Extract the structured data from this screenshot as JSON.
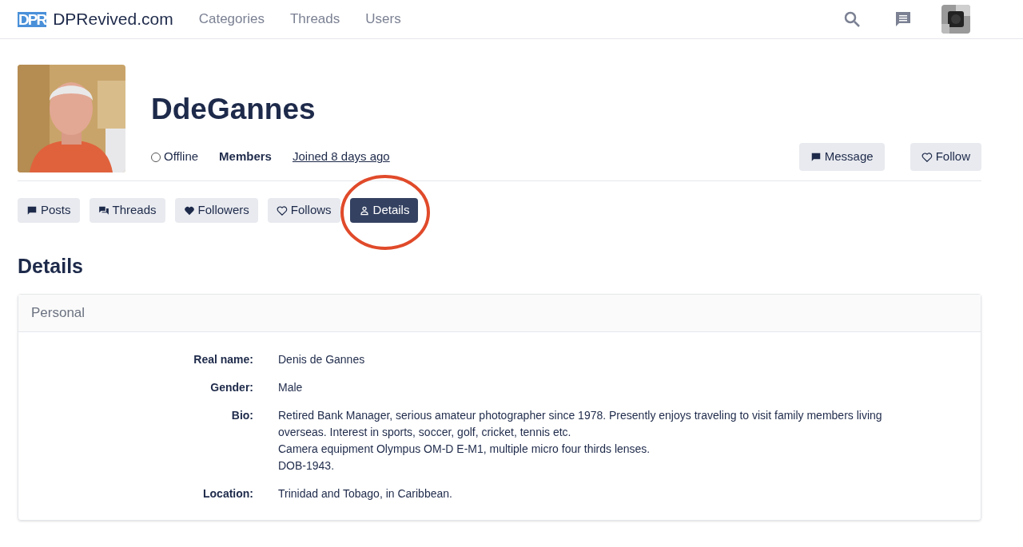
{
  "site": {
    "logo": "DPR",
    "name": "DPRevived.com",
    "nav": [
      "Categories",
      "Threads",
      "Users"
    ]
  },
  "profile": {
    "username": "DdeGannes",
    "status": "Offline",
    "online": false,
    "group": "Members",
    "joined": "Joined 8 days ago",
    "actions": [
      "Message",
      "Follow"
    ]
  },
  "tabs": [
    {
      "label": "Posts",
      "selected": false
    },
    {
      "label": "Threads",
      "selected": false
    },
    {
      "label": "Followers",
      "selected": false
    },
    {
      "label": "Follows",
      "selected": false
    },
    {
      "label": "Details",
      "selected": true
    }
  ],
  "section_title": "Details",
  "card": {
    "title": "Personal",
    "fields": [
      {
        "label": "Real name:",
        "lines": [
          "Denis de Gannes"
        ]
      },
      {
        "label": "Gender:",
        "lines": [
          "Male"
        ]
      },
      {
        "label": "Bio:",
        "lines": [
          "Retired Bank Manager, serious amateur photographer since 1978. Presently enjoys traveling to visit family members living overseas. Interest in sports, soccer, golf, cricket, tennis etc.",
          "Camera equipment Olympus OM-D E-M1, multiple micro four thirds lenses.",
          "DOB-1943."
        ]
      },
      {
        "label": "Location:",
        "lines": [
          "Trinidad and Tobago, in Caribbean."
        ]
      }
    ]
  }
}
